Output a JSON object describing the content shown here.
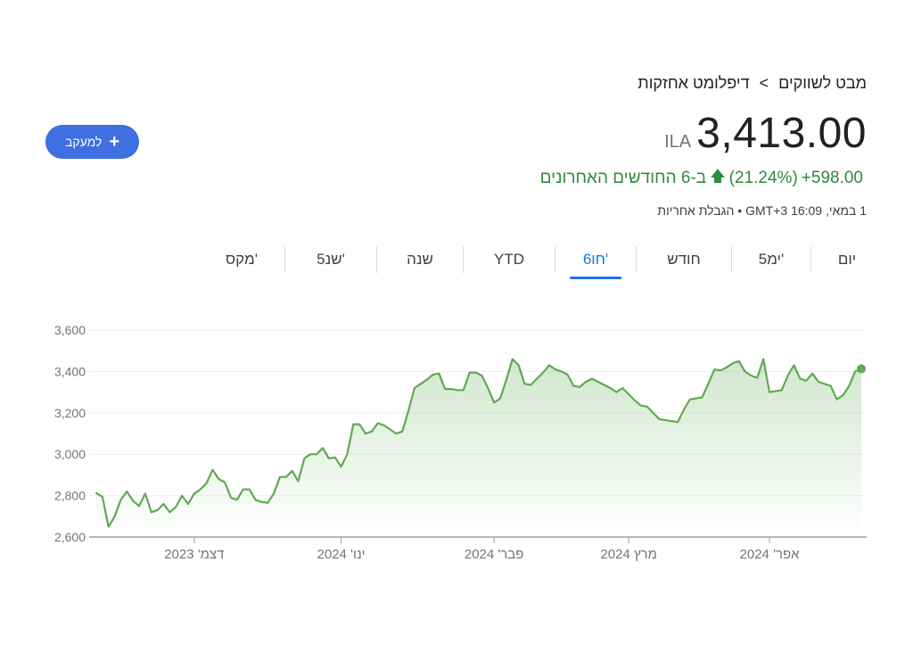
{
  "breadcrumb": {
    "parent": "מבט לשווקים",
    "separator": ">",
    "current": "דיפלומט אחזקות"
  },
  "follow_button": {
    "label": "למעקב"
  },
  "quote": {
    "currency": "ILA",
    "price": "3,413.00"
  },
  "change": {
    "amount": "+598.00",
    "percent": "(21.24%)",
    "period": "ב-6 החודשים האחרונים"
  },
  "updated": {
    "text": "1 במאי, 16:09 GMT+3 • הגבלת אחריות"
  },
  "tabs": [
    {
      "label": "יום",
      "active": false
    },
    {
      "label": "5ימ'",
      "active": false
    },
    {
      "label": "חודש",
      "active": false
    },
    {
      "label": "6חו'",
      "active": true
    },
    {
      "label": "YTD",
      "active": false
    },
    {
      "label": "שנה",
      "active": false
    },
    {
      "label": "5שנ'",
      "active": false
    },
    {
      "label": "מקס'",
      "active": false
    }
  ],
  "colors": {
    "line": "#5faa52",
    "accent": "#1a73e8",
    "button": "#3f6fe0"
  },
  "chart_data": {
    "type": "area",
    "ylim": [
      2600,
      3600
    ],
    "yticks": [
      2600,
      2800,
      3000,
      3200,
      3400,
      3600
    ],
    "ytick_labels": [
      "2,600",
      "2,800",
      "3,000",
      "3,200",
      "3,400",
      "3,600"
    ],
    "xticks": [
      {
        "index": 16,
        "label": "דצמ' 2023"
      },
      {
        "index": 40,
        "label": "ינו' 2024"
      },
      {
        "index": 65,
        "label": "פבר' 2024"
      },
      {
        "index": 87,
        "label": "מרץ 2024"
      },
      {
        "index": 110,
        "label": "אפר' 2024"
      }
    ],
    "grid": true,
    "series": [
      {
        "values": [
          2812,
          2795,
          2650,
          2700,
          2780,
          2820,
          2775,
          2750,
          2810,
          2720,
          2730,
          2760,
          2720,
          2745,
          2800,
          2760,
          2810,
          2830,
          2860,
          2925,
          2880,
          2865,
          2790,
          2780,
          2830,
          2830,
          2780,
          2770,
          2765,
          2810,
          2890,
          2890,
          2920,
          2870,
          2980,
          3000,
          3000,
          3030,
          2980,
          2985,
          2940,
          3000,
          3145,
          3145,
          3100,
          3110,
          3150,
          3140,
          3120,
          3100,
          3110,
          3210,
          3320,
          3340,
          3360,
          3385,
          3390,
          3315,
          3315,
          3310,
          3310,
          3395,
          3395,
          3380,
          3320,
          3250,
          3270,
          3360,
          3460,
          3430,
          3340,
          3335,
          3365,
          3395,
          3430,
          3410,
          3400,
          3385,
          3330,
          3325,
          3350,
          3365,
          3350,
          3335,
          3320,
          3300,
          3320,
          3290,
          3260,
          3235,
          3230,
          3200,
          3170,
          3165,
          3160,
          3155,
          3215,
          3265,
          3270,
          3275,
          3340,
          3410,
          3405,
          3420,
          3440,
          3450,
          3400,
          3380,
          3370,
          3460,
          3300,
          3305,
          3310,
          3380,
          3430,
          3365,
          3355,
          3390,
          3350,
          3340,
          3330,
          3265,
          3285,
          3330,
          3400,
          3413
        ]
      }
    ]
  }
}
